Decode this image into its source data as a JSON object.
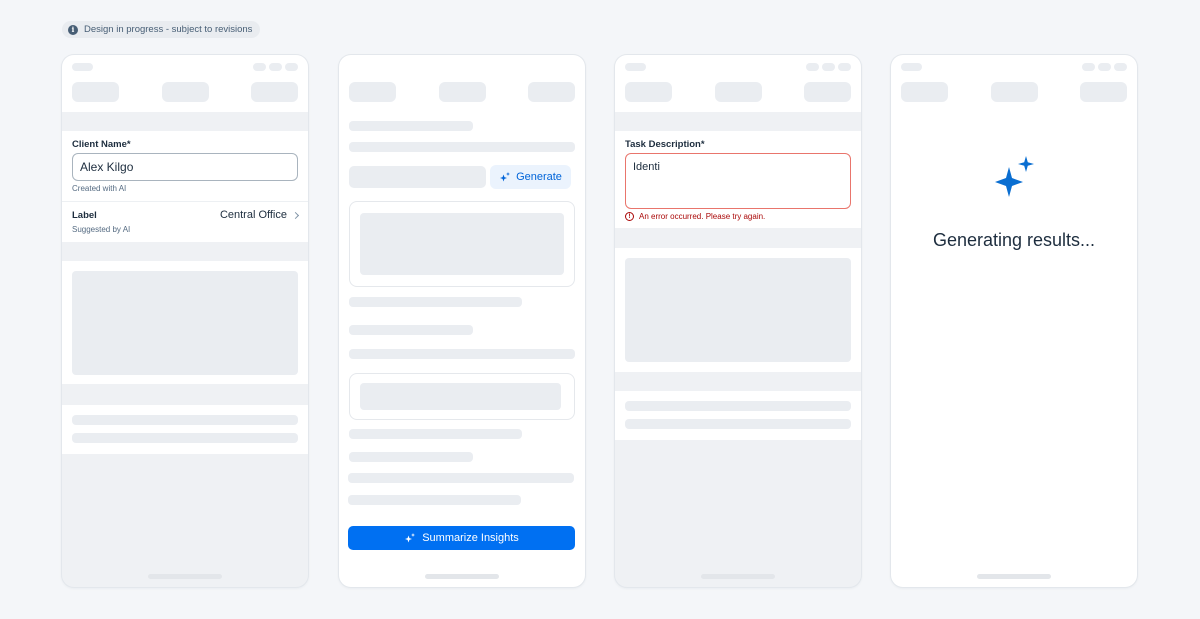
{
  "banner": {
    "text": "Design in progress - subject to revisions",
    "icon": "info-icon"
  },
  "screen1": {
    "client_label": "Client Name*",
    "client_value": "Alex Kilgo",
    "client_helper": "Created with AI",
    "label_label": "Label",
    "label_value": "Central Office",
    "label_helper": "Suggested by AI"
  },
  "screen2": {
    "generate_label": "Generate",
    "summarize_label": "Summarize Insights"
  },
  "screen3": {
    "task_label": "Task Description*",
    "task_value": "Identi",
    "error_text": "An error occurred. Please try again."
  },
  "screen4": {
    "status_text": "Generating results..."
  },
  "colors": {
    "accent": "#0070f2",
    "sparkle": "#0a6ed1",
    "error": "#aa0808",
    "error_border": "#e9756c"
  }
}
